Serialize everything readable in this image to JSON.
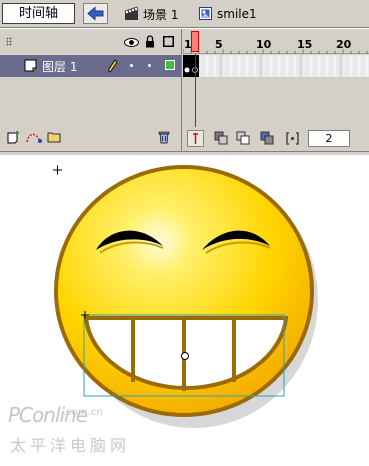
{
  "toolbar": {
    "timeline_button": "时间轴",
    "scene_label": "场景 1",
    "symbol_label": "smile1"
  },
  "layers": {
    "layer_name": "图层 1"
  },
  "ruler": {
    "ticks": [
      "1",
      "5",
      "10",
      "15",
      "20"
    ]
  },
  "frames": {
    "current_frame": "2"
  },
  "watermark": {
    "brand": "PConline",
    "domain": ".com.cn",
    "chinese": "太平洋电脑网"
  },
  "colors": {
    "panel": "#d4d0c8",
    "layer_selected": "#6b6b8e",
    "face_yellow": "#ffd500",
    "face_outline": "#9a6b06",
    "selection_box": "#2aa3b8"
  }
}
